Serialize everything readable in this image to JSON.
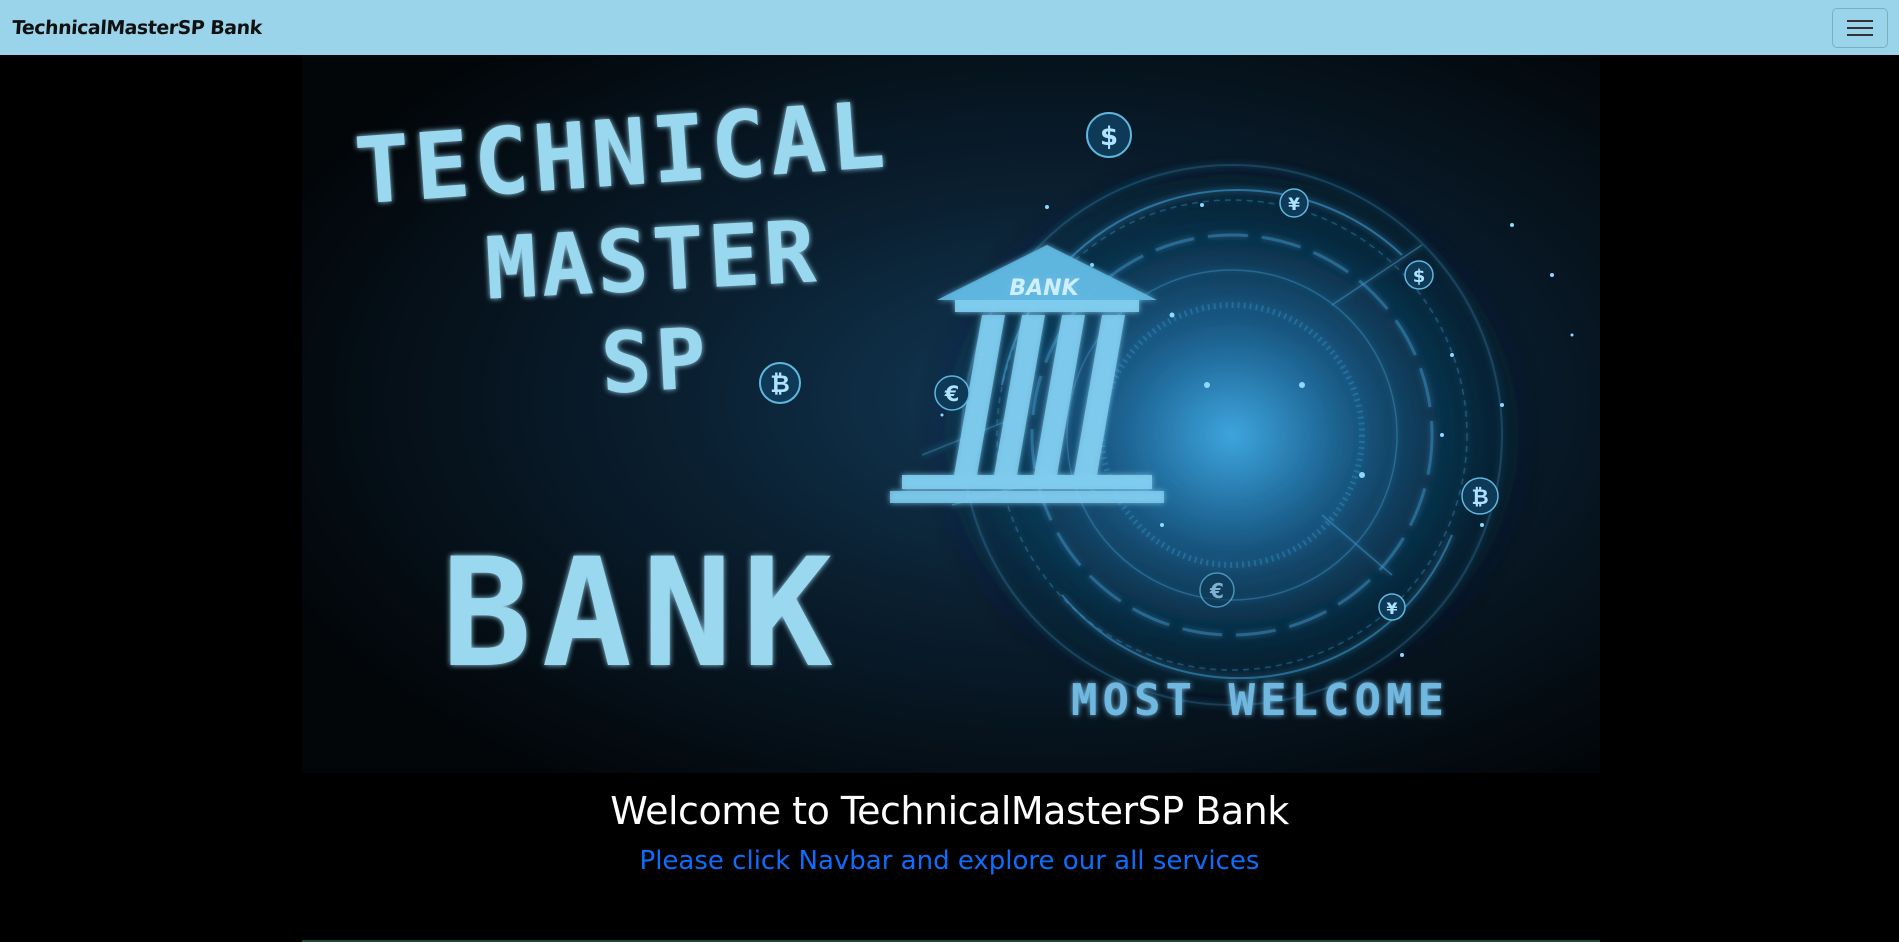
{
  "navbar": {
    "brand": "TechnicalMasterSP Bank",
    "toggler_icon": "hamburger-menu-icon",
    "background": "#9ad4ea"
  },
  "hero": {
    "title_lines": [
      "TECHNICAL",
      "MASTER",
      "SP"
    ],
    "bank_word": "BANK",
    "welcome_text": "MOST WELCOME",
    "building_label": "BANK",
    "currency_symbols": [
      "$",
      "¥",
      "$",
      "₿",
      "€",
      "₿",
      "€",
      "¥"
    ],
    "glow_color": "#7fd0f0"
  },
  "content": {
    "welcome_title": "Welcome to TechnicalMasterSP Bank",
    "welcome_subtitle": "Please click Navbar and explore our all services",
    "subtitle_color": "#0d6efd"
  }
}
